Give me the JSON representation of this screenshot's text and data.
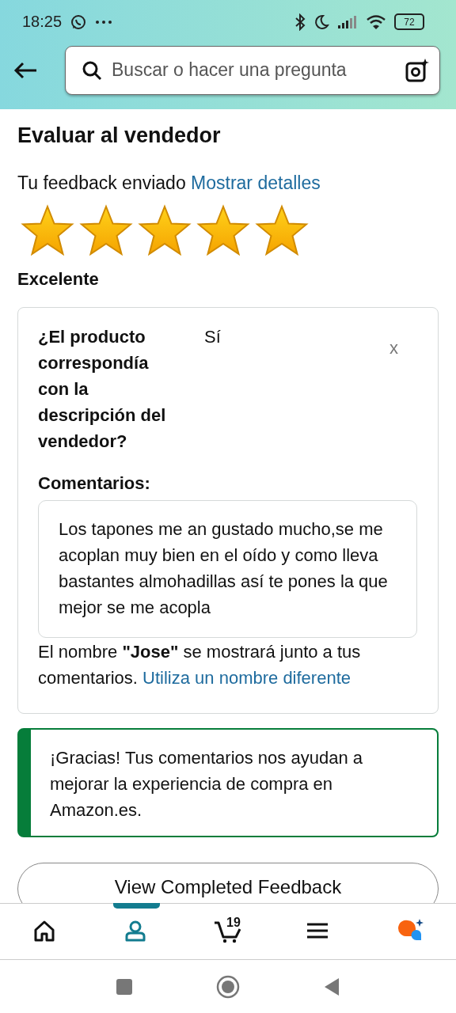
{
  "status_bar": {
    "time": "18:25",
    "battery": "72"
  },
  "search": {
    "placeholder": "Buscar o hacer una pregunta"
  },
  "page": {
    "title": "Evaluar al vendedor",
    "feedback_label": "Tu feedback enviado",
    "details_link": "Mostrar detalles"
  },
  "rating": {
    "stars": 5,
    "label": "Excelente"
  },
  "question": {
    "text": "¿El producto correspondía con la descripción del vendedor?",
    "answer": "Sí",
    "close": "x"
  },
  "comments": {
    "label": "Comentarios:",
    "text": "Los tapones me an gustado mucho,se me acoplan muy bien en el oído y como lleva bastantes almohadillas así te pones la que mejor se me acopla"
  },
  "name_note": {
    "text": "El nombre **\"Jose\"** se mostrará junto a tus comentarios.",
    "link": "Utiliza un nombre diferente"
  },
  "thanks": {
    "text": "¡Gracias! Tus comentarios nos ayudan a mejorar la experiencia de compra en Amazon.es."
  },
  "button": {
    "label": "View Completed Feedback"
  },
  "bottom_nav": [
    {
      "kind": "home",
      "selected": false
    },
    {
      "kind": "account",
      "selected": true
    },
    {
      "kind": "cart",
      "selected": false,
      "count": "19"
    },
    {
      "kind": "menu",
      "selected": false
    },
    {
      "kind": "assistant",
      "selected": false
    }
  ]
}
